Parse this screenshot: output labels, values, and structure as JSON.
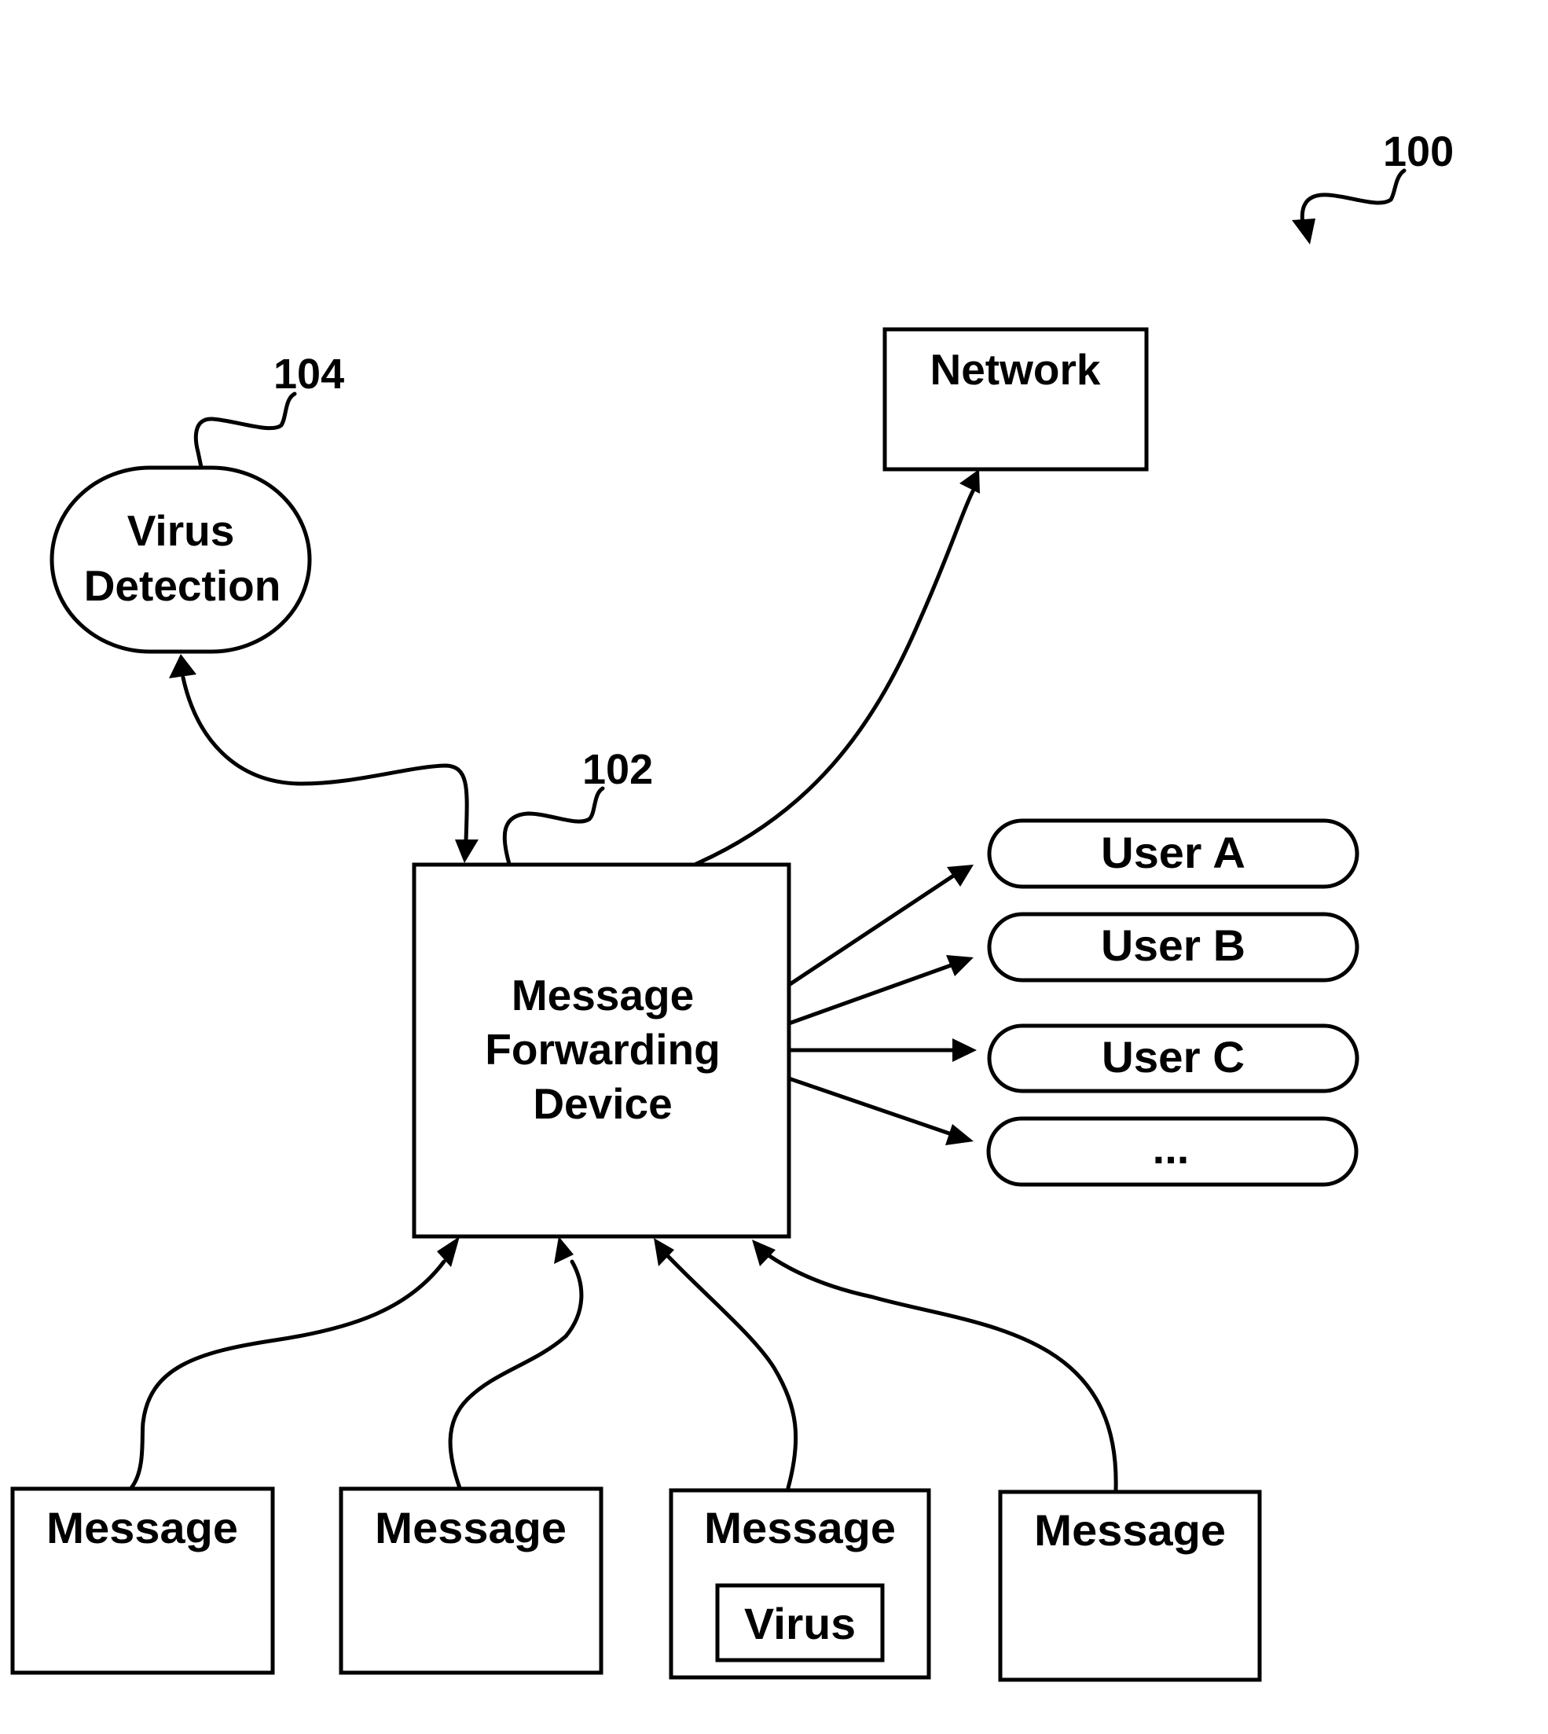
{
  "figure": {
    "ref_label": "100"
  },
  "virus_detection": {
    "ref_label": "104",
    "line1": "Virus",
    "line2": "Detection"
  },
  "network": {
    "label": "Network"
  },
  "message_forwarding_device": {
    "ref_label": "102",
    "line1": "Message",
    "line2": "Forwarding",
    "line3": "Device"
  },
  "users": [
    {
      "label": "User A"
    },
    {
      "label": "User B"
    },
    {
      "label": "User C"
    },
    {
      "label": "..."
    }
  ],
  "messages": [
    {
      "label": "Message",
      "attachment": null
    },
    {
      "label": "Message",
      "attachment": null
    },
    {
      "label": "Message",
      "attachment": "Virus"
    },
    {
      "label": "Message",
      "attachment": null
    }
  ],
  "colors": {
    "stroke": "#000000",
    "background": "#ffffff"
  }
}
